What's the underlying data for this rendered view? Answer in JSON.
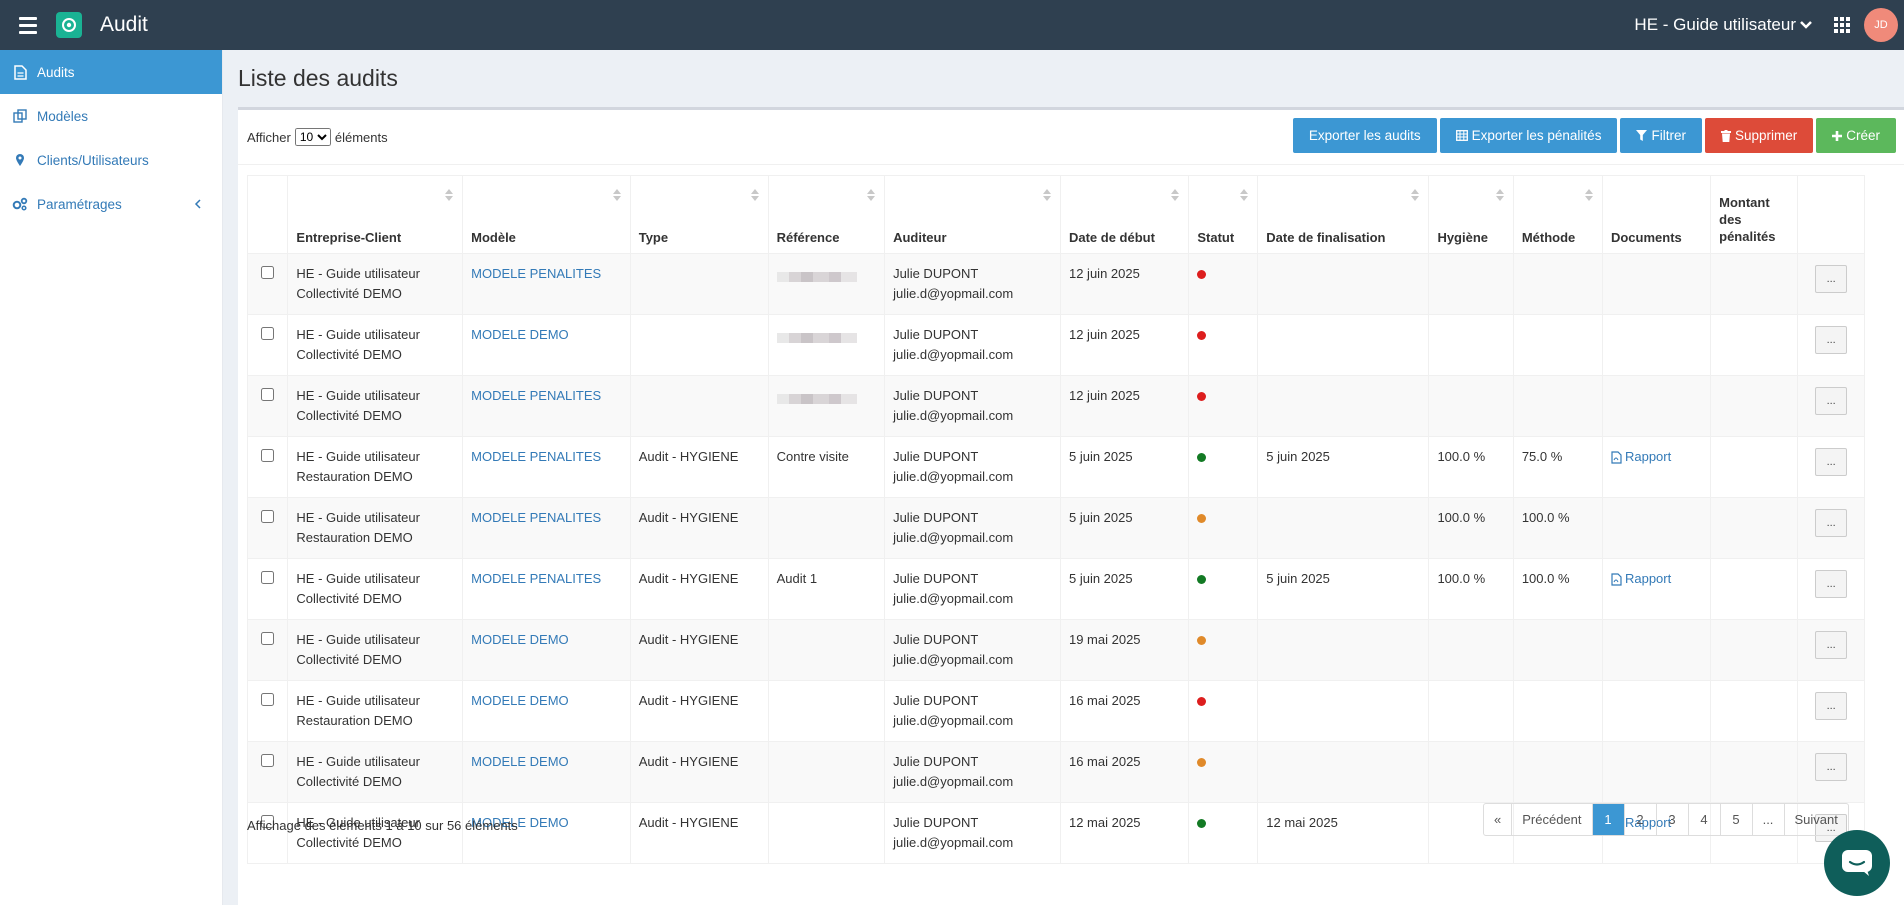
{
  "app": {
    "title": "Audit",
    "org": "HE - Guide utilisateur",
    "avatar": "JD"
  },
  "sidebar": {
    "items": [
      {
        "label": "Audits",
        "icon": "file-icon"
      },
      {
        "label": "Modèles",
        "icon": "copy-icon"
      },
      {
        "label": "Clients/Utilisateurs",
        "icon": "map-marker-icon"
      },
      {
        "label": "Paramétrages",
        "icon": "gears-icon"
      }
    ]
  },
  "page": {
    "title": "Liste des audits"
  },
  "length": {
    "prefix": "Afficher",
    "value": "10",
    "suffix": "éléments"
  },
  "toolbar": {
    "export_audits": "Exporter les audits",
    "export_penalties": "Exporter les pénalités",
    "filter": "Filtrer",
    "delete": "Supprimer",
    "create": "Créer"
  },
  "columns": [
    "Entreprise-Client",
    "Modèle",
    "Type",
    "Référence",
    "Auditeur",
    "Date de début",
    "Statut",
    "Date de finalisation",
    "Hygiène",
    "Méthode",
    "Documents",
    "Montant des pénalités"
  ],
  "rows": [
    {
      "client1": "HE - Guide utilisateur",
      "client2": "Collectivité DEMO",
      "model": "MODELE PENALITES",
      "type": "",
      "ref": "",
      "ref_blur": true,
      "aud1": "Julie DUPONT",
      "aud2": "julie.d@yopmail.com",
      "start": "12 juin 2025",
      "status": "red",
      "final": "",
      "hyg": "",
      "meth": "",
      "doc": "",
      "pen": ""
    },
    {
      "client1": "HE - Guide utilisateur",
      "client2": "Collectivité DEMO",
      "model": "MODELE DEMO",
      "type": "",
      "ref": "",
      "ref_blur": true,
      "aud1": "Julie DUPONT",
      "aud2": "julie.d@yopmail.com",
      "start": "12 juin 2025",
      "status": "red",
      "final": "",
      "hyg": "",
      "meth": "",
      "doc": "",
      "pen": ""
    },
    {
      "client1": "HE - Guide utilisateur",
      "client2": "Collectivité DEMO",
      "model": "MODELE PENALITES",
      "type": "",
      "ref": "",
      "ref_blur": true,
      "aud1": "Julie DUPONT",
      "aud2": "julie.d@yopmail.com",
      "start": "12 juin 2025",
      "status": "red",
      "final": "",
      "hyg": "",
      "meth": "",
      "doc": "",
      "pen": ""
    },
    {
      "client1": "HE - Guide utilisateur",
      "client2": "Restauration DEMO",
      "model": "MODELE PENALITES",
      "type": "Audit - HYGIENE",
      "ref": "Contre visite",
      "ref_blur": false,
      "aud1": "Julie DUPONT",
      "aud2": "julie.d@yopmail.com",
      "start": "5 juin 2025",
      "status": "green",
      "final": "5 juin 2025",
      "hyg": "100.0 %",
      "meth": "75.0 %",
      "doc": "Rapport",
      "pen": ""
    },
    {
      "client1": "HE - Guide utilisateur",
      "client2": "Restauration DEMO",
      "model": "MODELE PENALITES",
      "type": "Audit - HYGIENE",
      "ref": "",
      "ref_blur": false,
      "aud1": "Julie DUPONT",
      "aud2": "julie.d@yopmail.com",
      "start": "5 juin 2025",
      "status": "orange",
      "final": "",
      "hyg": "100.0 %",
      "meth": "100.0 %",
      "doc": "",
      "pen": ""
    },
    {
      "client1": "HE - Guide utilisateur",
      "client2": "Collectivité DEMO",
      "model": "MODELE PENALITES",
      "type": "Audit - HYGIENE",
      "ref": "Audit 1",
      "ref_blur": false,
      "aud1": "Julie DUPONT",
      "aud2": "julie.d@yopmail.com",
      "start": "5 juin 2025",
      "status": "green",
      "final": "5 juin 2025",
      "hyg": "100.0 %",
      "meth": "100.0 %",
      "doc": "Rapport",
      "pen": ""
    },
    {
      "client1": "HE - Guide utilisateur",
      "client2": "Collectivité DEMO",
      "model": "MODELE DEMO",
      "type": "Audit - HYGIENE",
      "ref": "",
      "ref_blur": false,
      "aud1": "Julie DUPONT",
      "aud2": "julie.d@yopmail.com",
      "start": "19 mai 2025",
      "status": "orange",
      "final": "",
      "hyg": "",
      "meth": "",
      "doc": "",
      "pen": ""
    },
    {
      "client1": "HE - Guide utilisateur",
      "client2": "Restauration DEMO",
      "model": "MODELE DEMO",
      "type": "Audit - HYGIENE",
      "ref": "",
      "ref_blur": false,
      "aud1": "Julie DUPONT",
      "aud2": "julie.d@yopmail.com",
      "start": "16 mai 2025",
      "status": "red",
      "final": "",
      "hyg": "",
      "meth": "",
      "doc": "",
      "pen": ""
    },
    {
      "client1": "HE - Guide utilisateur",
      "client2": "Collectivité DEMO",
      "model": "MODELE DEMO",
      "type": "Audit - HYGIENE",
      "ref": "",
      "ref_blur": false,
      "aud1": "Julie DUPONT",
      "aud2": "julie.d@yopmail.com",
      "start": "16 mai 2025",
      "status": "orange",
      "final": "",
      "hyg": "",
      "meth": "",
      "doc": "",
      "pen": ""
    },
    {
      "client1": "HE - Guide utilisateur",
      "client2": "Collectivité DEMO",
      "model": "MODELE DEMO",
      "type": "Audit - HYGIENE",
      "ref": "",
      "ref_blur": false,
      "aud1": "Julie DUPONT",
      "aud2": "julie.d@yopmail.com",
      "start": "12 mai 2025",
      "status": "green",
      "final": "12 mai 2025",
      "hyg": "",
      "meth": "",
      "doc": "Rapport",
      "pen": ""
    }
  ],
  "action_label": "...",
  "info": "Affichage des élements 1 à 10 sur 56 éléments",
  "pager": {
    "first": "«",
    "prev": "Précédent",
    "pages": [
      "1",
      "2",
      "3",
      "4",
      "5"
    ],
    "ellipsis": "...",
    "next": "Suivant"
  },
  "colors": {
    "topbar": "#2f4050",
    "accent": "#3c97d3",
    "red": "#dd4b39",
    "green": "#5cb85c"
  }
}
